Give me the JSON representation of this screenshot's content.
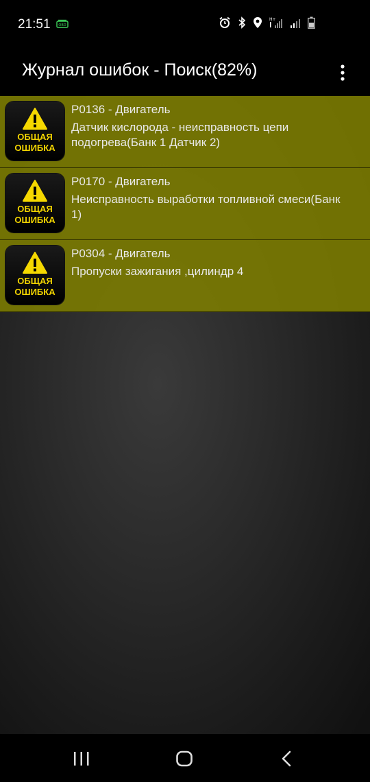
{
  "status_bar": {
    "time": "21:51",
    "obd_label": "OBD",
    "icons": [
      "alarm-icon",
      "bluetooth-icon",
      "location-icon",
      "signal-icon",
      "signal-icon",
      "battery-icon"
    ]
  },
  "app_bar": {
    "title": "Журнал ошибок - Поиск(82%)",
    "menu_icon": "overflow-menu-icon"
  },
  "faults": [
    {
      "badge_line1": "ОБЩАЯ",
      "badge_line2": "ОШИБКА",
      "code": "P0136 - Двигатель",
      "description": "Датчик кислорода - неисправность цепи подогрева(Банк 1 Датчик 2)"
    },
    {
      "badge_line1": "ОБЩАЯ",
      "badge_line2": "ОШИБКА",
      "code": "P0170 - Двигатель",
      "description": "Неисправность выработки топливной смеси(Банк 1)"
    },
    {
      "badge_line1": "ОБЩАЯ",
      "badge_line2": "ОШИБКА",
      "code": "P0304 - Двигатель",
      "description": "Пропуски зажигания ,цилиндр 4"
    }
  ],
  "colors": {
    "row_bg": "#7d7d00",
    "badge_text": "#f2d400",
    "warning_yellow": "#f5d800"
  },
  "nav_bar": {
    "buttons": [
      "recents-icon",
      "home-icon",
      "back-icon"
    ]
  }
}
